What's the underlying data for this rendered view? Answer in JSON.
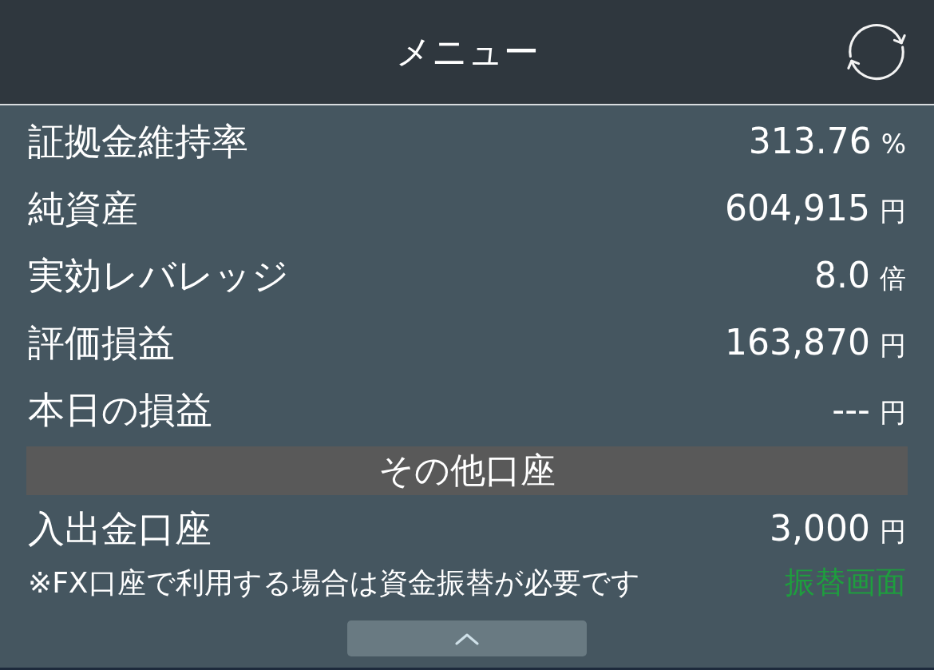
{
  "header": {
    "title": "メニュー"
  },
  "metrics": [
    {
      "label": "証拠金維持率",
      "value": "313.76",
      "unit": "%"
    },
    {
      "label": "純資産",
      "value": "604,915",
      "unit": "円"
    },
    {
      "label": "実効レバレッジ",
      "value": "8.0",
      "unit": "倍"
    },
    {
      "label": "評価損益",
      "value": "163,870",
      "unit": "円"
    },
    {
      "label": "本日の損益",
      "value": "---",
      "unit": "円"
    }
  ],
  "section": {
    "title": "その他口座"
  },
  "accounts": [
    {
      "label": "入出金口座",
      "value": "3,000",
      "unit": "円"
    }
  ],
  "note": {
    "text": "※FX口座で利用する場合は資金振替が必要です",
    "link": "振替画面"
  }
}
